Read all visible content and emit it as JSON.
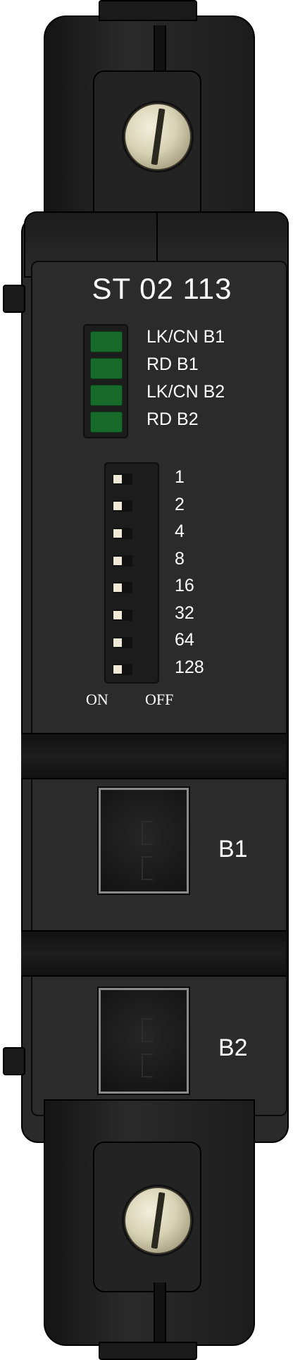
{
  "device": {
    "model": "ST 02 113",
    "led_indicators": [
      {
        "label": "LK/CN B1",
        "color": "#186a2a"
      },
      {
        "label": "RD B1",
        "color": "#186a2a"
      },
      {
        "label": "LK/CN B2",
        "color": "#186a2a"
      },
      {
        "label": "RD B2",
        "color": "#186a2a"
      }
    ],
    "dip_switch": {
      "values": [
        "1",
        "2",
        "4",
        "8",
        "16",
        "32",
        "64",
        "128"
      ],
      "on_label": "ON",
      "off_label": "OFF"
    },
    "ports": [
      {
        "label": "B1"
      },
      {
        "label": "B2"
      }
    ]
  },
  "colors": {
    "housing": "#2a2a2a",
    "led_green": "#186a2a",
    "screw": "#d8d2b4",
    "text": "#ffffff"
  }
}
